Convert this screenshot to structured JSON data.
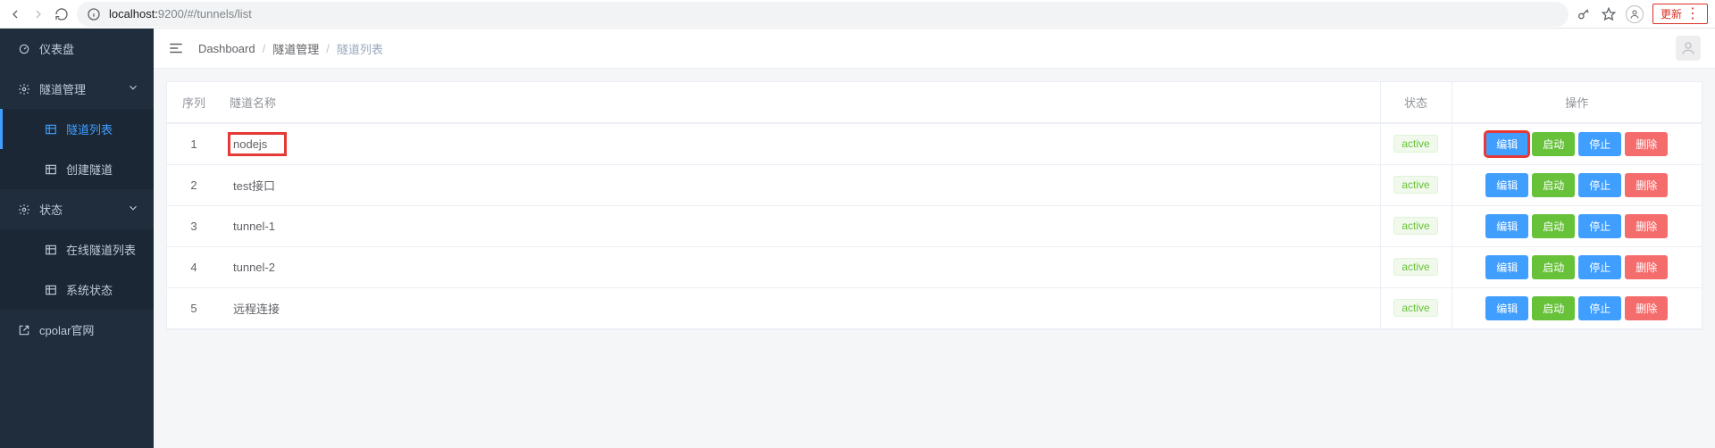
{
  "browser": {
    "host": "localhost:",
    "port_and_path": "9200/#/tunnels/list",
    "update_label": "更新"
  },
  "sidebar": {
    "dashboard": "仪表盘",
    "tunnel_mgmt": "隧道管理",
    "tunnel_list": "隧道列表",
    "create_tunnel": "创建隧道",
    "status": "状态",
    "online_tunnel_list": "在线隧道列表",
    "system_status": "系统状态",
    "cpolar_site": "cpolar官网"
  },
  "breadcrumb": {
    "dashboard": "Dashboard",
    "tunnel_mgmt": "隧道管理",
    "tunnel_list": "隧道列表"
  },
  "table": {
    "headers": {
      "index": "序列",
      "name": "隧道名称",
      "status": "状态",
      "actions": "操作"
    },
    "actions": {
      "edit": "编辑",
      "start": "启动",
      "stop": "停止",
      "delete": "删除"
    },
    "rows": [
      {
        "index": "1",
        "name": "nodejs",
        "status": "active"
      },
      {
        "index": "2",
        "name": "test接口",
        "status": "active"
      },
      {
        "index": "3",
        "name": "tunnel-1",
        "status": "active"
      },
      {
        "index": "4",
        "name": "tunnel-2",
        "status": "active"
      },
      {
        "index": "5",
        "name": "远程连接",
        "status": "active"
      }
    ],
    "highlight_row_index": 0
  }
}
